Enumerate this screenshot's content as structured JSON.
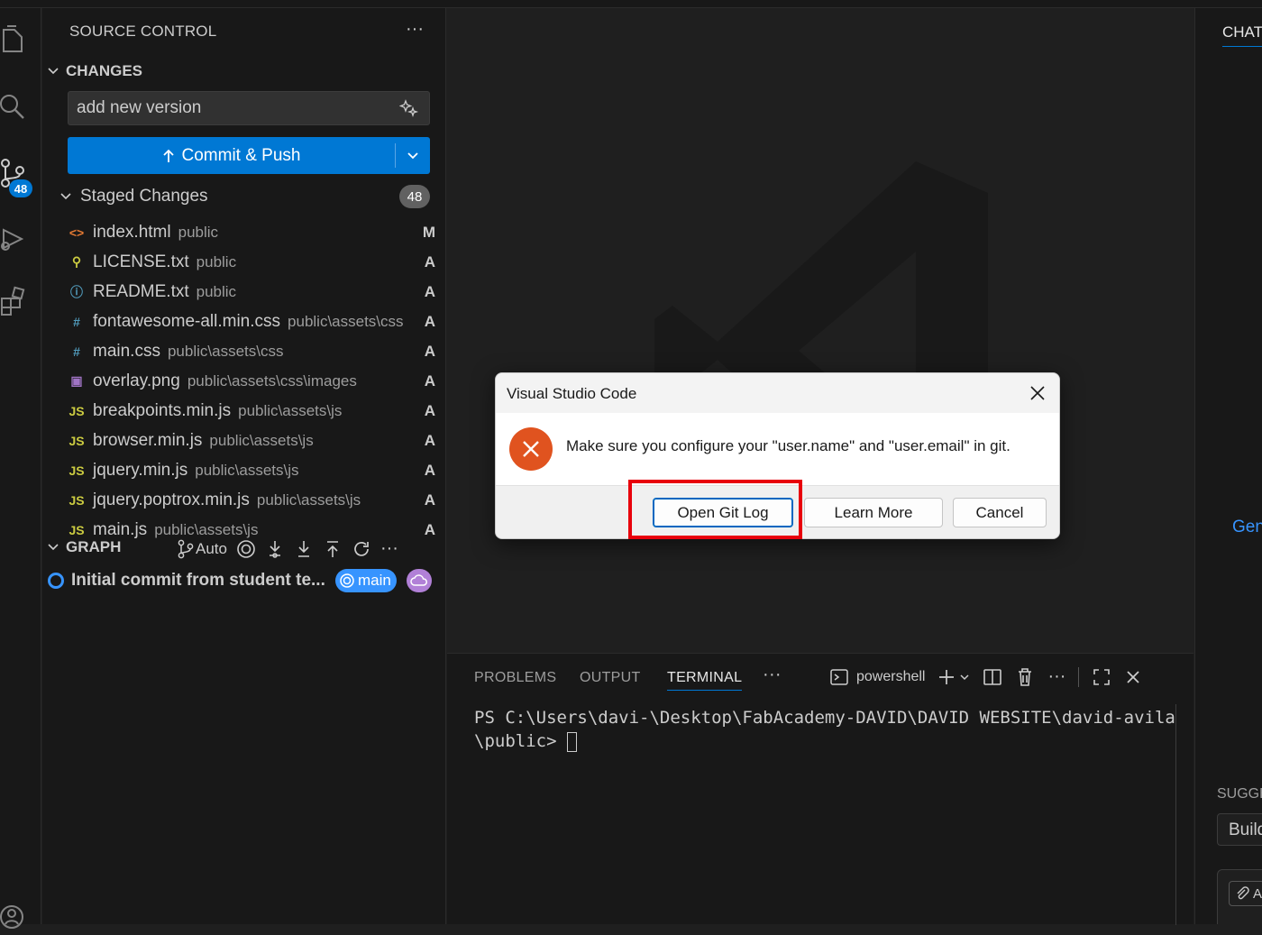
{
  "sidebar": {
    "title": "SOURCE CONTROL",
    "more": "···",
    "changes_header": "CHANGES",
    "message_value": "add new version",
    "commit_label": "Commit & Push",
    "staged_label": "Staged Changes",
    "staged_count": "48",
    "scm_badge": "48",
    "files": [
      {
        "name": "index.html",
        "path": "public",
        "status": "M",
        "icon": "html-icon",
        "glyph": "<>",
        "color": "#e37933"
      },
      {
        "name": "LICENSE.txt",
        "path": "public",
        "status": "A",
        "icon": "license-icon",
        "glyph": "⚲",
        "color": "#cbcb41"
      },
      {
        "name": "README.txt",
        "path": "public",
        "status": "A",
        "icon": "info-icon",
        "glyph": "ⓘ",
        "color": "#519aba"
      },
      {
        "name": "fontawesome-all.min.css",
        "path": "public\\assets\\css",
        "status": "A",
        "icon": "css-icon",
        "glyph": "#",
        "color": "#519aba"
      },
      {
        "name": "main.css",
        "path": "public\\assets\\css",
        "status": "A",
        "icon": "css-icon",
        "glyph": "#",
        "color": "#519aba"
      },
      {
        "name": "overlay.png",
        "path": "public\\assets\\css\\images",
        "status": "A",
        "icon": "image-icon",
        "glyph": "▣",
        "color": "#a074c4"
      },
      {
        "name": "breakpoints.min.js",
        "path": "public\\assets\\js",
        "status": "A",
        "icon": "js-icon",
        "glyph": "JS",
        "color": "#cbcb41"
      },
      {
        "name": "browser.min.js",
        "path": "public\\assets\\js",
        "status": "A",
        "icon": "js-icon",
        "glyph": "JS",
        "color": "#cbcb41"
      },
      {
        "name": "jquery.min.js",
        "path": "public\\assets\\js",
        "status": "A",
        "icon": "js-icon",
        "glyph": "JS",
        "color": "#cbcb41"
      },
      {
        "name": "jquery.poptrox.min.js",
        "path": "public\\assets\\js",
        "status": "A",
        "icon": "js-icon",
        "glyph": "JS",
        "color": "#cbcb41"
      },
      {
        "name": "main.js",
        "path": "public\\assets\\js",
        "status": "A",
        "icon": "js-icon",
        "glyph": "JS",
        "color": "#cbcb41"
      }
    ],
    "graph_header": "GRAPH",
    "graph_auto": "Auto",
    "commit_message": "Initial commit from student te...",
    "branch": "main"
  },
  "panel": {
    "tabs": [
      "PROBLEMS",
      "OUTPUT",
      "TERMINAL"
    ],
    "more": "···",
    "shell": "powershell",
    "terminal_text": "PS C:\\Users\\davi-\\Desktop\\FabAcademy-DAVID\\DAVID WEBSITE\\david-avila\\public> "
  },
  "chat": {
    "tab": "CHAT",
    "gen": "Gen",
    "suggested": "SUGGE",
    "build": "Build",
    "attach": "A"
  },
  "dialog": {
    "title": "Visual Studio Code",
    "message": "Make sure you configure your \"user.name\" and \"user.email\" in git.",
    "btn_gitlog": "Open Git Log",
    "btn_learn": "Learn More",
    "btn_cancel": "Cancel"
  },
  "colors": {
    "accent": "#0078d4",
    "error": "#e0531f",
    "highlight": "#e8000b"
  }
}
